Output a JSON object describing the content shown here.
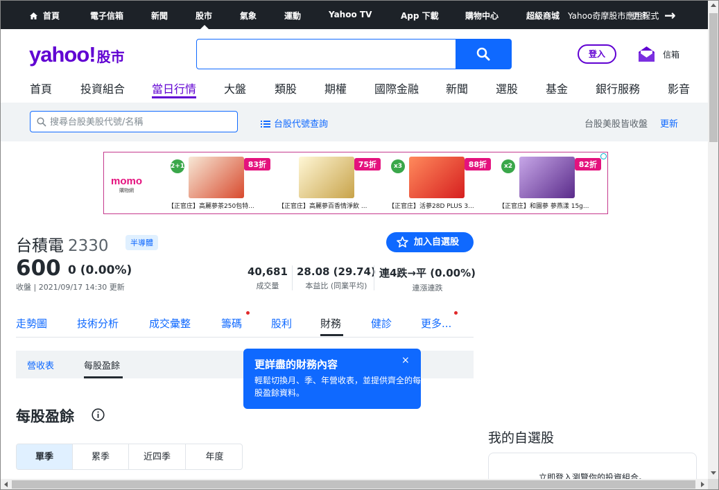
{
  "topbar": {
    "items": [
      "首頁",
      "電子信箱",
      "新聞",
      "股市",
      "氣象",
      "運動",
      "Yahoo TV",
      "App 下載",
      "購物中心",
      "超級商城",
      "Yahoo奇摩股市應用程式"
    ],
    "overflow_label": "更多"
  },
  "header": {
    "logo": "yahoo!",
    "logo_sub": "股市",
    "search_placeholder": "",
    "login_label": "登入",
    "mail_label": "信箱"
  },
  "nav": {
    "items": [
      "首頁",
      "投資組合",
      "當日行情",
      "大盤",
      "類股",
      "期權",
      "國際金融",
      "新聞",
      "選股",
      "基金",
      "銀行服務",
      "影音"
    ],
    "active": "當日行情"
  },
  "quote_search": {
    "placeholder": "搜尋台股美股代號/名稱",
    "code_link": "台股代號查詢",
    "market_status": "台股美股皆收盤",
    "refresh": "更新"
  },
  "ad": {
    "brand": "momo",
    "brand_sub": "購物網",
    "cards": [
      {
        "discount": "83折",
        "pack": "2+1",
        "caption": "【正官庄】高麗蔘茶250包特..."
      },
      {
        "discount": "75折",
        "pack": "",
        "caption": "【正官庄】高麗蔘百香情淨飲 ..."
      },
      {
        "discount": "88折",
        "pack": "x3",
        "caption": "【正官庄】活蔘28D PLUS 3..."
      },
      {
        "discount": "82折",
        "pack": "x2",
        "caption": "【正官庄】和園蔘 蔘燕漾 15g..."
      }
    ]
  },
  "quote": {
    "name": "台積電",
    "code": "2330",
    "sector": "半導體",
    "watch_label": "加入自選股",
    "price": "600",
    "change": "0 (0.00%)",
    "close_time": "收盤 | 2021/09/17 14:30 更新",
    "stats": [
      {
        "value": "40,681",
        "label": "成交量"
      },
      {
        "value": "28.08 (29.74)",
        "label": "本益比 (同業平均)"
      },
      {
        "value": "連4跌→平 (0.00%)",
        "label": "連漲連跌"
      }
    ]
  },
  "quote_tabs": {
    "items": [
      "走勢圖",
      "技術分析",
      "成交彙整",
      "籌碼",
      "股利",
      "財務",
      "健診",
      "更多..."
    ],
    "active": "財務"
  },
  "sub_tabs": {
    "items": [
      "營收表",
      "每股盈餘"
    ],
    "active": "每股盈餘"
  },
  "tooltip": {
    "title": "更詳盡的財務內容",
    "body": "輕鬆切換月、季、年營收表，並提供齊全的每股盈餘資料。",
    "close": "×"
  },
  "section": {
    "title": "每股盈餘",
    "period_tabs": [
      "單季",
      "累季",
      "近四季",
      "年度"
    ],
    "active_period": "單季"
  },
  "sidebar": {
    "title": "我的自選股",
    "message": "立即登入瀏覽你的投資組合。"
  },
  "colors": {
    "brand": "#6001d2",
    "accent": "#0f69ff",
    "topbar": "#1d2228",
    "ad_pink": "#e4127e"
  }
}
